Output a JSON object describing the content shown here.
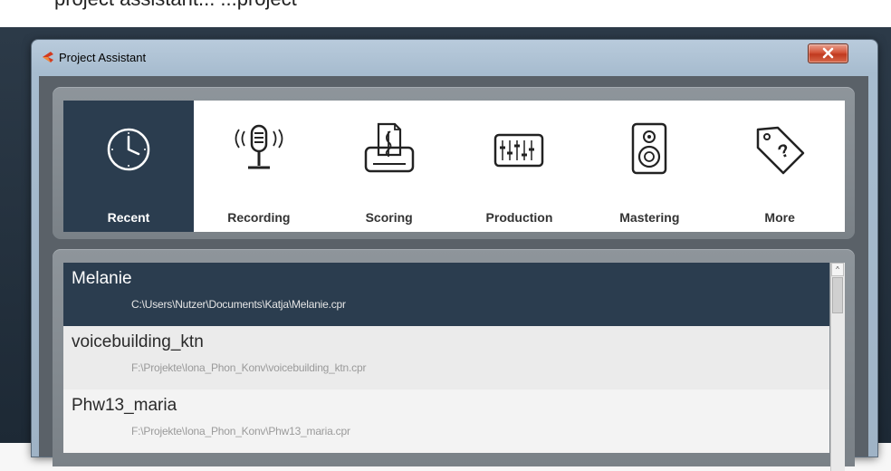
{
  "background_caption": "project assistant... ...project",
  "window": {
    "title": "Project Assistant",
    "close_symbol": "x"
  },
  "categories": [
    {
      "label": "Recent",
      "icon": "clock-icon",
      "active": true
    },
    {
      "label": "Recording",
      "icon": "microphone-icon",
      "active": false
    },
    {
      "label": "Scoring",
      "icon": "score-printer-icon",
      "active": false
    },
    {
      "label": "Production",
      "icon": "mixer-faders-icon",
      "active": false
    },
    {
      "label": "Mastering",
      "icon": "speaker-icon",
      "active": false
    },
    {
      "label": "More",
      "icon": "tag-question-icon",
      "active": false
    }
  ],
  "projects": [
    {
      "name": "Melanie",
      "path": "C:\\Users\\Nutzer\\Documents\\Katja\\Melanie.cpr",
      "selected": true
    },
    {
      "name": "voicebuilding_ktn",
      "path": "F:\\Projekte\\Iona_Phon_Konv\\voicebuilding_ktn.cpr",
      "selected": false
    },
    {
      "name": "Phw13_maria",
      "path": "F:\\Projekte\\Iona_Phon_Konv\\Phw13_maria.cpr",
      "selected": false
    }
  ],
  "scrollbar": {
    "up_symbol": "^"
  },
  "colors": {
    "selection": "#2b3d4f",
    "close_button": "#c0391f",
    "panel": "#7a8187"
  }
}
